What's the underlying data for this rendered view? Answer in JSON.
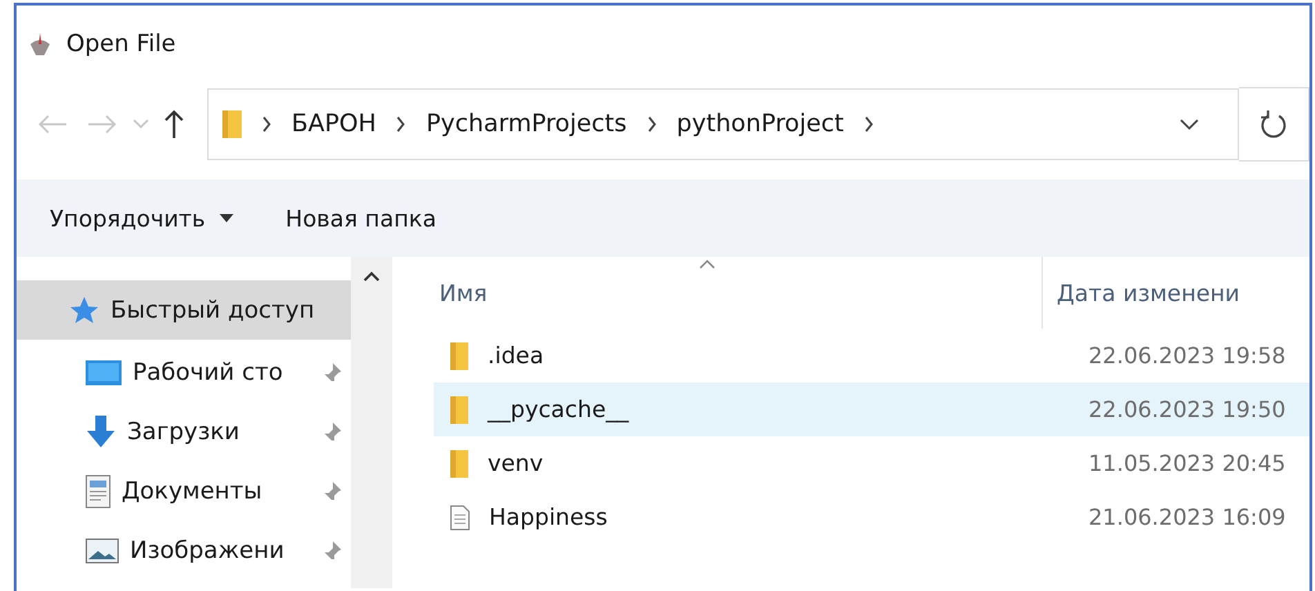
{
  "window": {
    "title": "Open File"
  },
  "address": {
    "crumbs": [
      "БАРОН",
      "PycharmProjects",
      "pythonProject"
    ]
  },
  "toolbar": {
    "organize": "Упорядочить",
    "new_folder": "Новая папка"
  },
  "sidebar": {
    "items": [
      {
        "label": "Быстрый доступ",
        "kind": "star",
        "pinned": false,
        "selected": true
      },
      {
        "label": "Рабочий сто",
        "kind": "desktop",
        "pinned": true,
        "selected": false
      },
      {
        "label": "Загрузки",
        "kind": "download",
        "pinned": true,
        "selected": false
      },
      {
        "label": "Документы",
        "kind": "document",
        "pinned": true,
        "selected": false
      },
      {
        "label": "Изображени",
        "kind": "image",
        "pinned": true,
        "selected": false
      }
    ]
  },
  "table": {
    "columns": [
      "Имя",
      "Дата изменени"
    ],
    "rows": [
      {
        "kind": "folder",
        "name": ".idea",
        "date": "22.06.2023 19:58",
        "selected": false
      },
      {
        "kind": "folder",
        "name": "__pycache__",
        "date": "22.06.2023 19:50",
        "selected": true
      },
      {
        "kind": "folder",
        "name": "venv",
        "date": "11.05.2023 20:45",
        "selected": false
      },
      {
        "kind": "file",
        "name": "Happiness",
        "date": "21.06.2023 16:09",
        "selected": false
      }
    ]
  }
}
